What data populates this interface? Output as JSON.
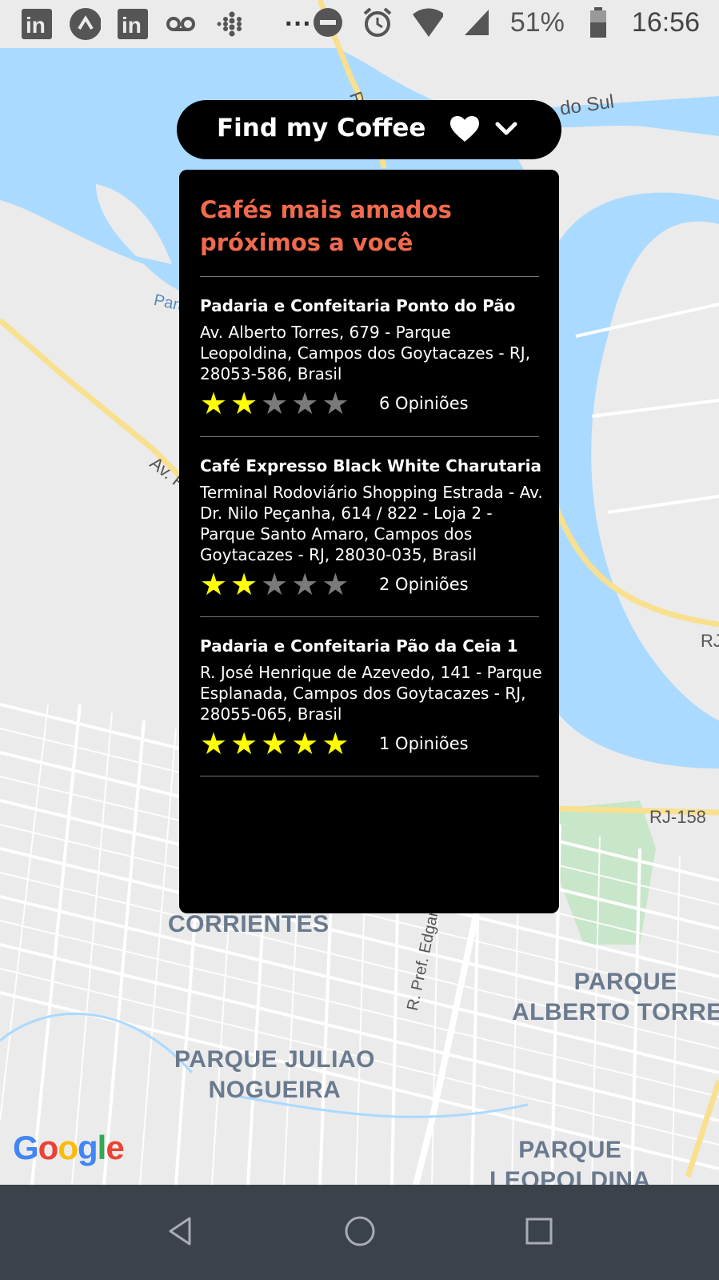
{
  "status_bar": {
    "battery": "51%",
    "time": "16:56",
    "more": "···"
  },
  "map": {
    "labels": [
      "CORRIENTES",
      "PARQUE\nALBERTO TORRES",
      "PARQUE JULIAO\nNOGUEIRA",
      "PARQUE\nLEOPOLDINA"
    ],
    "road_labels": [
      "do Sul",
      "RJ-158",
      "R. Pref. Edgard Macha",
      "Av. F",
      "Para",
      "RJ",
      "R"
    ],
    "google": [
      "G",
      "o",
      "o",
      "g",
      "l",
      "e"
    ]
  },
  "header": {
    "title": "Find my Coffee"
  },
  "panel": {
    "title": "Cafés mais amados próximos a você",
    "cafes": [
      {
        "name": "Padaria e Confeitaria Ponto do Pão",
        "address": "Av. Alberto Torres, 679 - Parque Leopoldina, Campos dos Goytacazes - RJ, 28053-586, Brasil",
        "rating": 2,
        "reviews": "6 Opiniões"
      },
      {
        "name": "Café Expresso Black White Charutaria",
        "address": "Terminal Rodoviário Shopping Estrada - Av. Dr. Nilo Peçanha, 614 / 822 - Loja 2 - Parque Santo Amaro, Campos dos Goytacazes - RJ, 28030-035, Brasil",
        "rating": 2,
        "reviews": "2 Opiniões"
      },
      {
        "name": "Padaria e Confeitaria Pão da Ceia 1",
        "address": "R. José Henrique de Azevedo, 141 - Parque Esplanada, Campos dos Goytacazes - RJ, 28055-065, Brasil",
        "rating": 5,
        "reviews": "1 Opiniões"
      }
    ]
  },
  "colors": {
    "accent": "#f06a4e",
    "star_on": "#ffff00",
    "star_off": "#7a7a7a",
    "water": "#aadaff",
    "park": "#c8e6c9"
  }
}
